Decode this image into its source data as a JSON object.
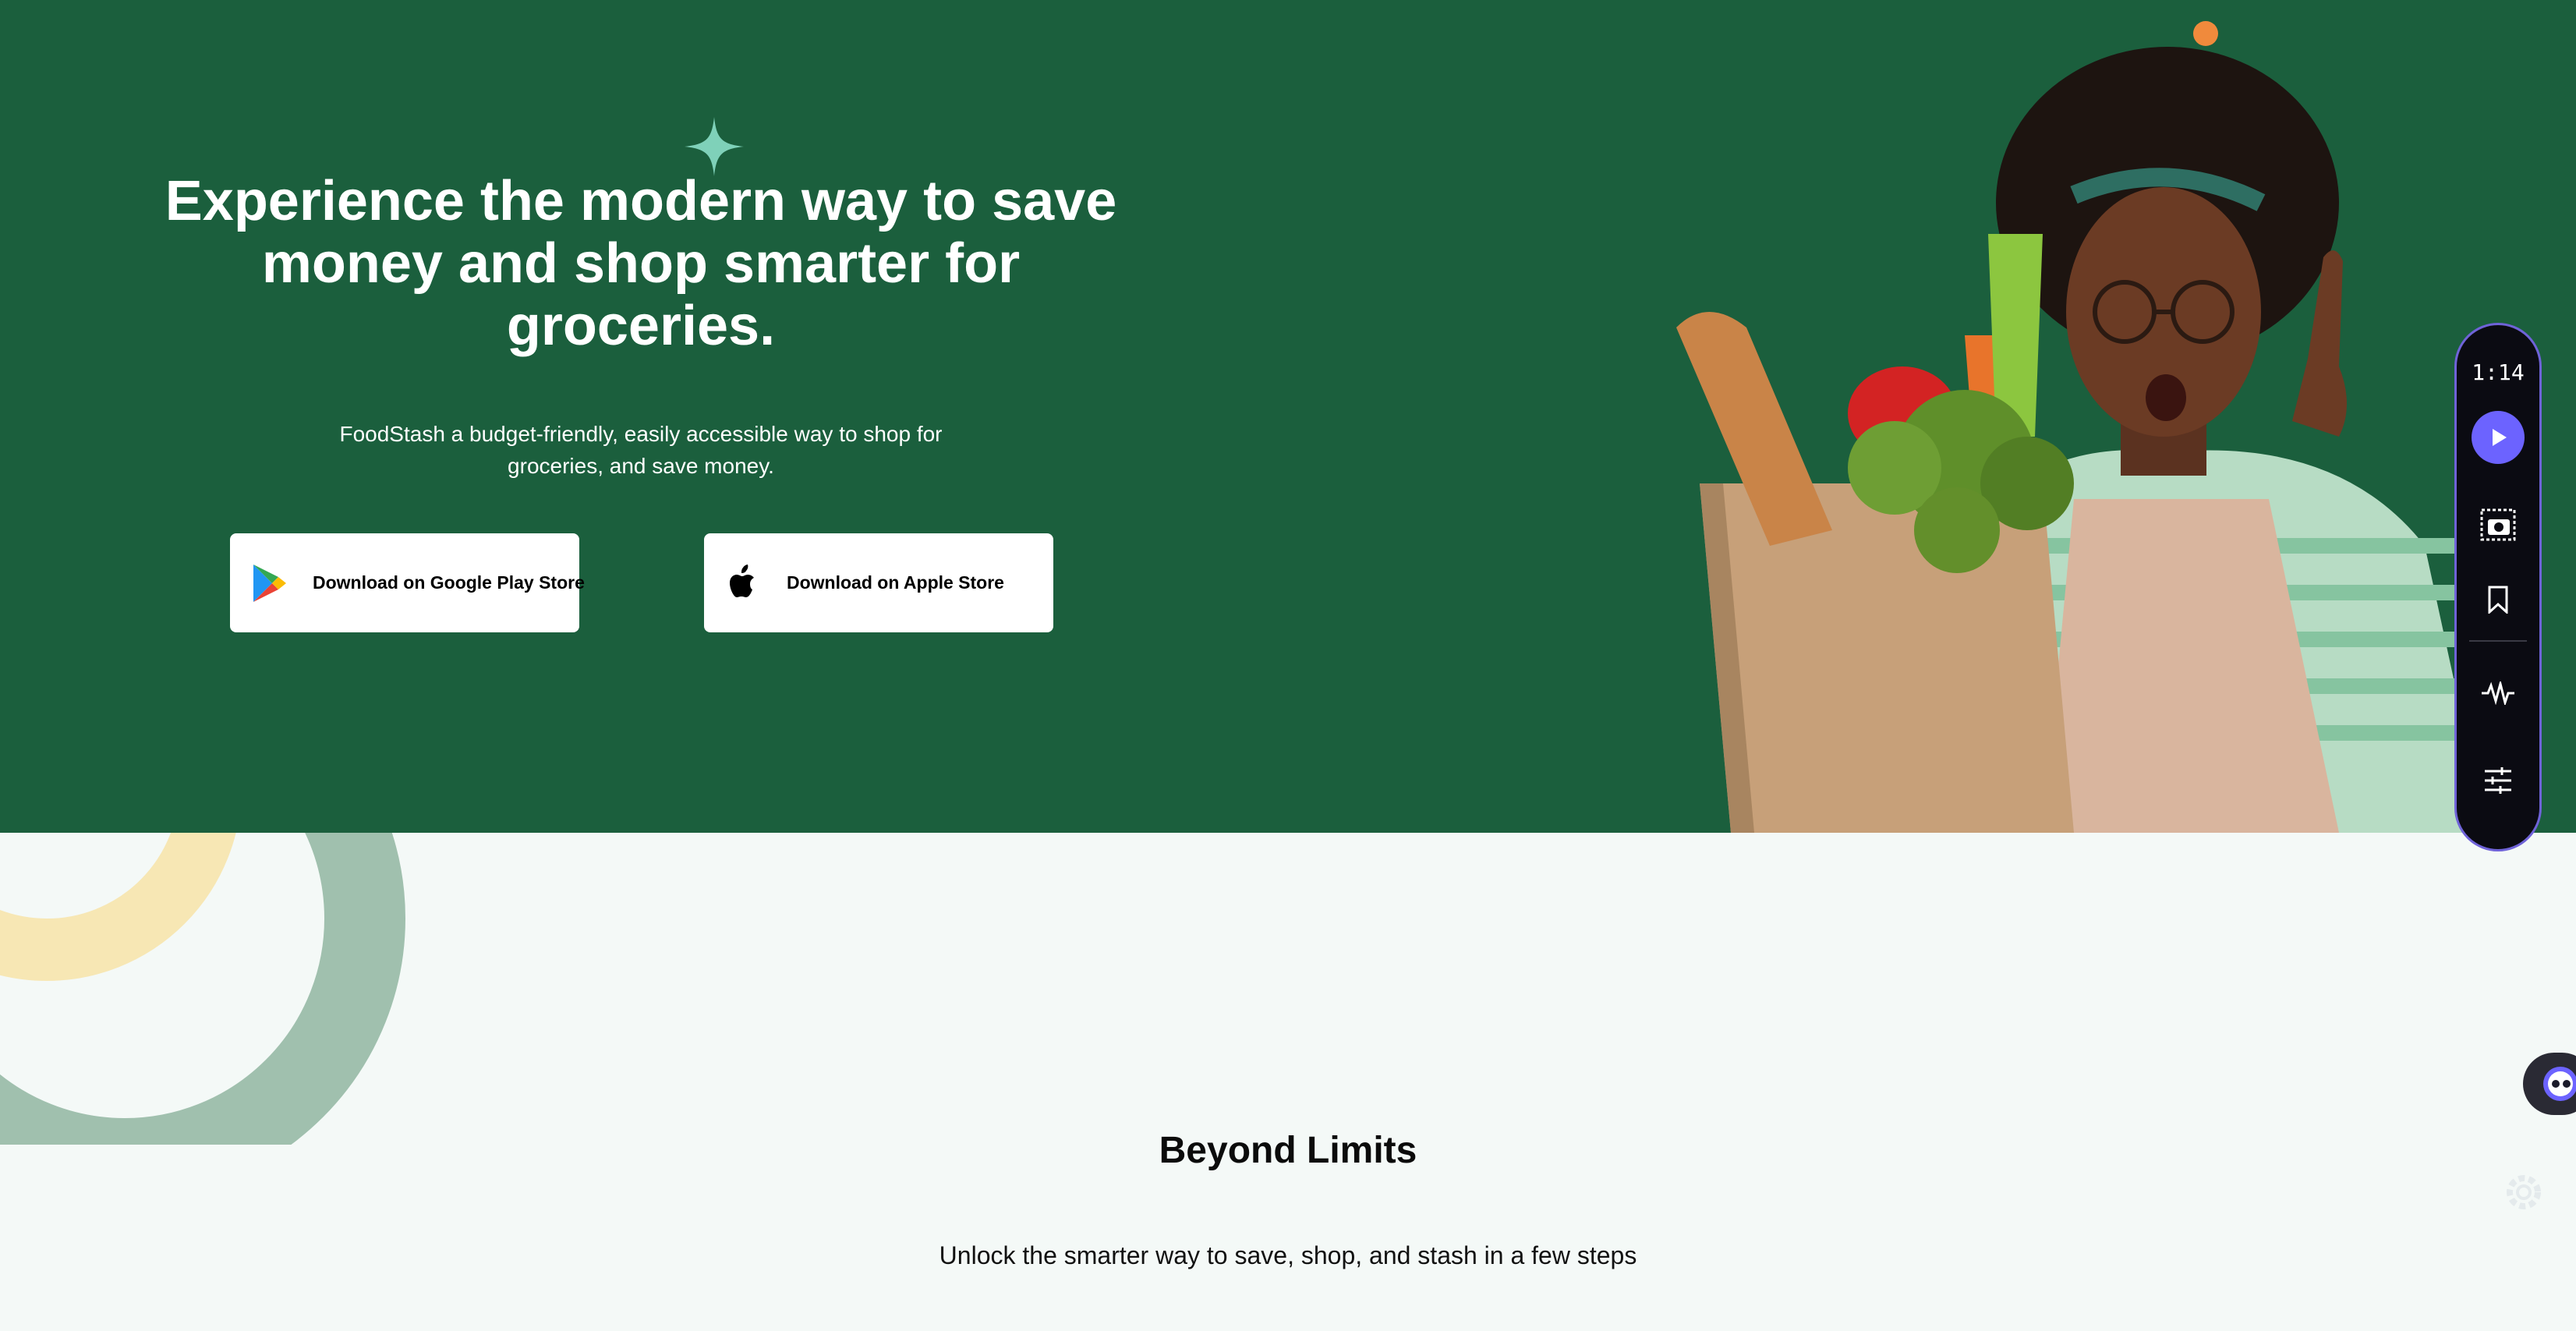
{
  "hero": {
    "headline": "Experience the modern way to save money and shop smarter for groceries.",
    "subtext": "FoodStash a budget-friendly, easily accessible way to shop for groceries, and save money.",
    "buttons": {
      "google_play": "Download on Google Play Store",
      "apple_store": "Download on Apple Store"
    }
  },
  "recorder": {
    "timer": "1:14",
    "icons": [
      "play-icon",
      "screenshot-icon",
      "bookmark-icon",
      "waveform-icon",
      "sliders-icon"
    ]
  },
  "section": {
    "title": "Beyond Limits",
    "subtitle": "Unlock the smarter way to save, shop, and stash in a few steps"
  },
  "colors": {
    "hero_bg": "#1b5f3d",
    "page_bg": "#f4f9f7",
    "sparkle": "#7fd1b9",
    "ring_green": "#a0c0ae",
    "ring_yellow": "#f7e7b4",
    "recorder_accent": "#6c63ff"
  }
}
